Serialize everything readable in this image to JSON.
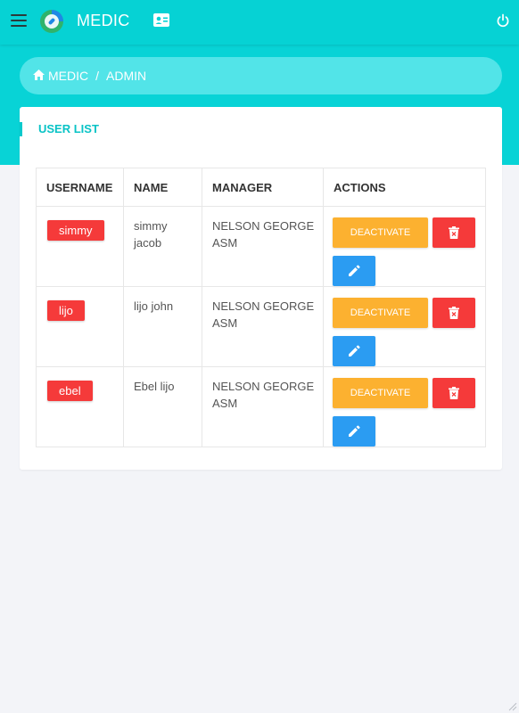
{
  "app": {
    "brand": "MEDIC",
    "icons": {
      "menu": "menu-icon",
      "logo": "app-logo-icon",
      "contact": "contact-card-icon",
      "power": "power-icon"
    },
    "colors": {
      "primary": "#06d2d4",
      "danger": "#f53a3a",
      "warning": "#fcb130",
      "info": "#2b9cf2"
    }
  },
  "breadcrumb": {
    "home": "MEDIC",
    "separator": "/",
    "current": "ADMIN"
  },
  "card": {
    "title": "USER LIST"
  },
  "table": {
    "headers": [
      "USERNAME",
      "NAME",
      "MANAGER",
      "ACTIONS"
    ],
    "deactivate_label": "DEACTIVATE",
    "rows": [
      {
        "username": "simmy",
        "name": "simmy jacob",
        "manager": "NELSON GEORGE ASM"
      },
      {
        "username": "lijo",
        "name": "lijo john",
        "manager": "NELSON GEORGE ASM"
      },
      {
        "username": "ebel",
        "name": "Ebel lijo",
        "manager": "NELSON GEORGE ASM"
      }
    ]
  }
}
